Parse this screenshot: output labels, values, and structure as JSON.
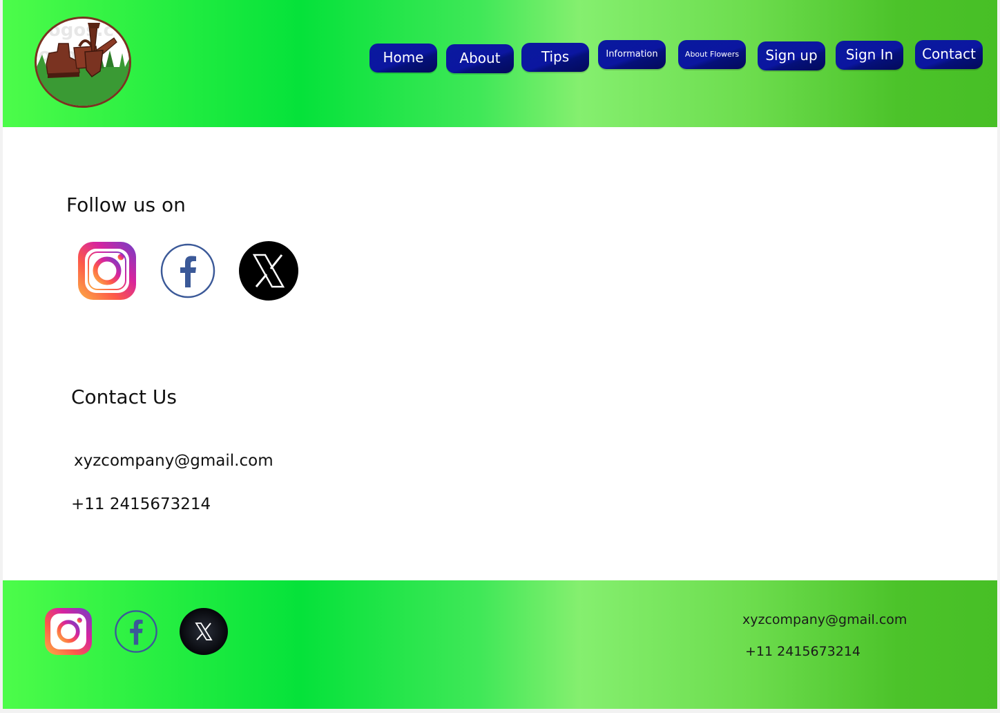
{
  "header": {
    "logo_icon": "gardening-tools-logo-icon",
    "logo_watermark": "logos.c",
    "nav": [
      {
        "label": "Home"
      },
      {
        "label": "About"
      },
      {
        "label": "Tips"
      },
      {
        "label": "Information"
      },
      {
        "label": "About Flowers"
      },
      {
        "label": "Sign up"
      },
      {
        "label": "Sign In"
      },
      {
        "label": "Contact"
      }
    ],
    "nav_color": "#0b16a0",
    "gradient_colors": [
      "#4dfc4a",
      "#05e23a",
      "#85ef6f",
      "#47bf26"
    ]
  },
  "main": {
    "follow_heading": "Follow us on",
    "social_icons": [
      "instagram-icon",
      "facebook-icon",
      "x-icon"
    ],
    "contact_heading": "Contact Us",
    "email": "xyzcompany@gmail.com",
    "phone": "+11 2415673214"
  },
  "footer": {
    "social_icons": [
      "instagram-icon",
      "facebook-icon",
      "x-icon"
    ],
    "email": "xyzcompany@gmail.com",
    "phone": "+11 2415673214"
  }
}
